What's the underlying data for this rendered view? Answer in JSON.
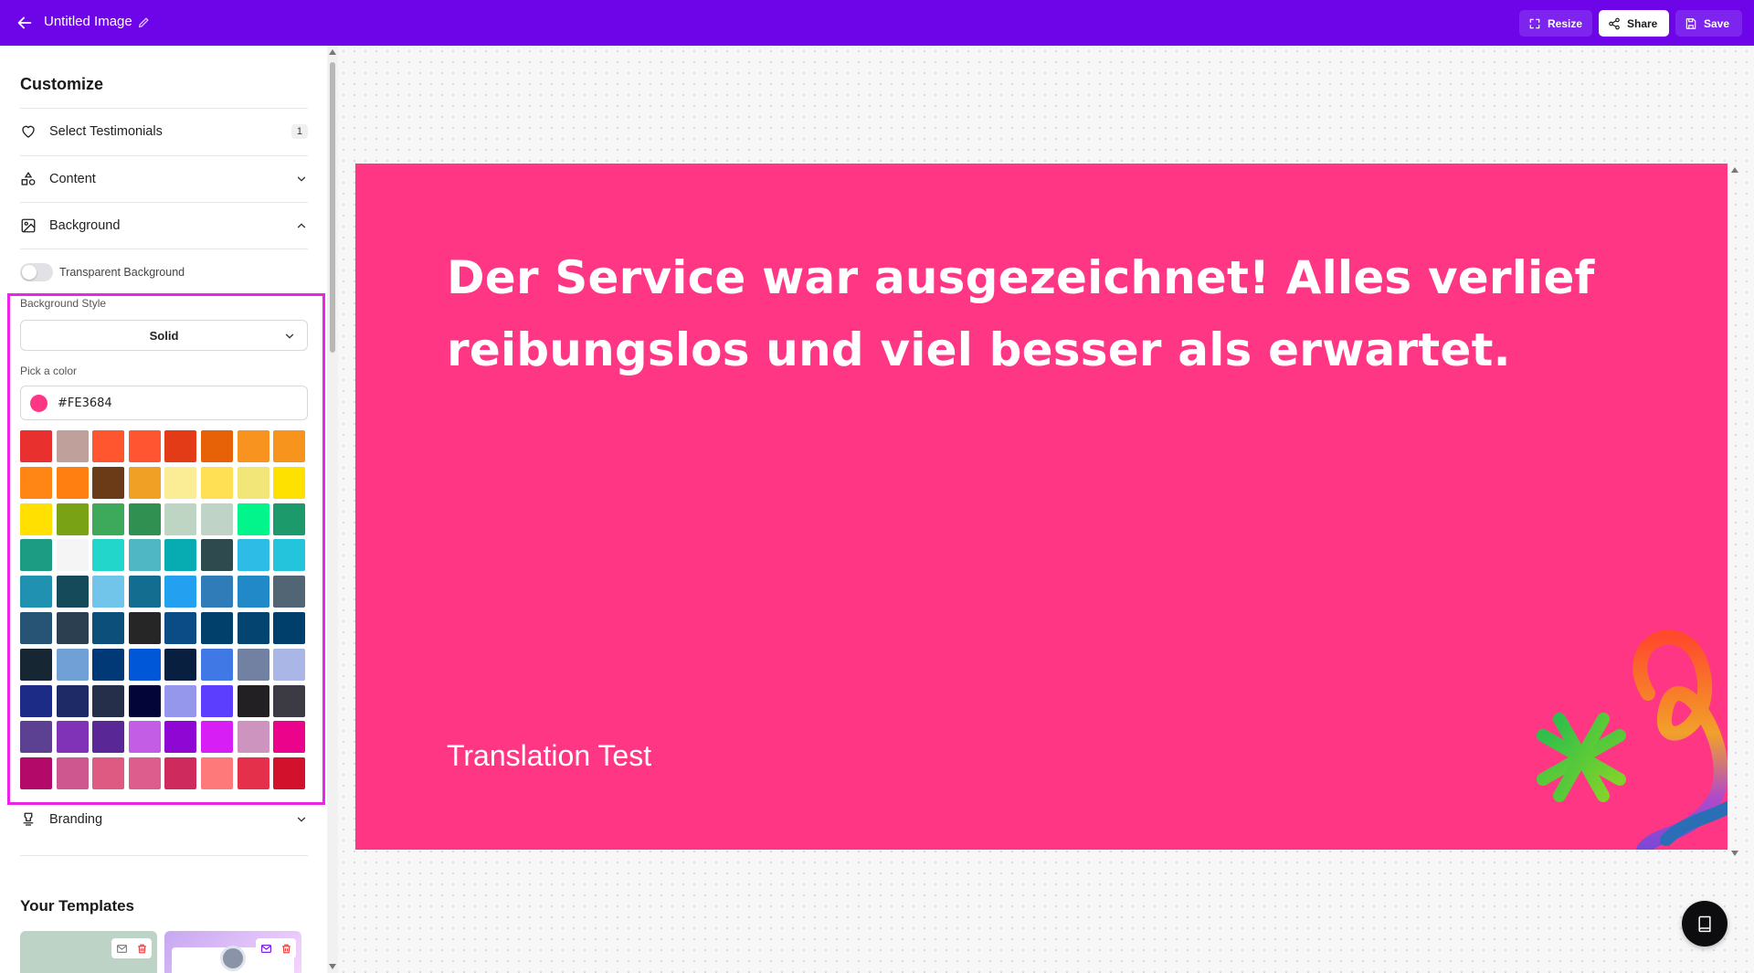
{
  "header": {
    "title": "Untitled Image",
    "resize_label": "Resize",
    "share_label": "Share",
    "save_label": "Save",
    "bg_color": "#6D05E8"
  },
  "sidebar": {
    "heading": "Customize",
    "sections": [
      {
        "label": "Select Testimonials",
        "badge": "1",
        "icon": "heart-icon"
      },
      {
        "label": "Content",
        "icon": "shapes-icon",
        "state": "collapsed"
      },
      {
        "label": "Background",
        "icon": "image-icon",
        "state": "expanded"
      },
      {
        "label": "Branding",
        "icon": "stamp-icon",
        "state": "collapsed"
      }
    ],
    "background": {
      "transparent_label": "Transparent Background",
      "transparent_on": false,
      "style_label": "Background Style",
      "style_value": "Solid",
      "pick_label": "Pick a color",
      "color_value": "#FE3684"
    },
    "templates_heading": "Your Templates"
  },
  "palette": [
    "#E8312F",
    "#BFA09A",
    "#FF5630",
    "#FF5631",
    "#E33B17",
    "#E76206",
    "#F7931E",
    "#F7941D",
    "#FF8614",
    "#FF8011",
    "#6A3B16",
    "#F1A026",
    "#FBEC96",
    "#FFE055",
    "#F2E678",
    "#FFE100",
    "#FFE000",
    "#79A214",
    "#3CA95B",
    "#2F9052",
    "#BED5C4",
    "#BFD4C6",
    "#02F58B",
    "#1C9A6B",
    "#1C9C83",
    "#F5F5F5",
    "#23D6CB",
    "#4EB7C3",
    "#06ACB2",
    "#2E4A4F",
    "#2CBCE6",
    "#24C4DD",
    "#2191B2",
    "#154A5A",
    "#71C5EB",
    "#136D91",
    "#23A1F0",
    "#2F7CB9",
    "#2289C8",
    "#526575",
    "#275375",
    "#2B3F50",
    "#0C4F7A",
    "#262626",
    "#0B4C86",
    "#01406B",
    "#034470",
    "#003E6B",
    "#162733",
    "#71A0D7",
    "#003975",
    "#0058D9",
    "#091F40",
    "#4079E5",
    "#7281A1",
    "#AAB6E6",
    "#1C2C86",
    "#1E2A66",
    "#262F4A",
    "#030538",
    "#9497EB",
    "#5C3EFE",
    "#222022",
    "#3C3B44",
    "#5C4192",
    "#8033B7",
    "#592896",
    "#C35DE5",
    "#8E07D2",
    "#D71FF5",
    "#CD94BF",
    "#EC038C",
    "#B30A6A",
    "#CF5790",
    "#DF5A82",
    "#DD5E8C",
    "#CF2A5E",
    "#FE7A7A",
    "#E4304A",
    "#D2122C"
  ],
  "canvas": {
    "bg_color": "#FE3684",
    "quote": "Der Service war ausgezeichnet! Alles verlief reibungslos und viel besser als erwartet.",
    "author": "Translation Test"
  }
}
